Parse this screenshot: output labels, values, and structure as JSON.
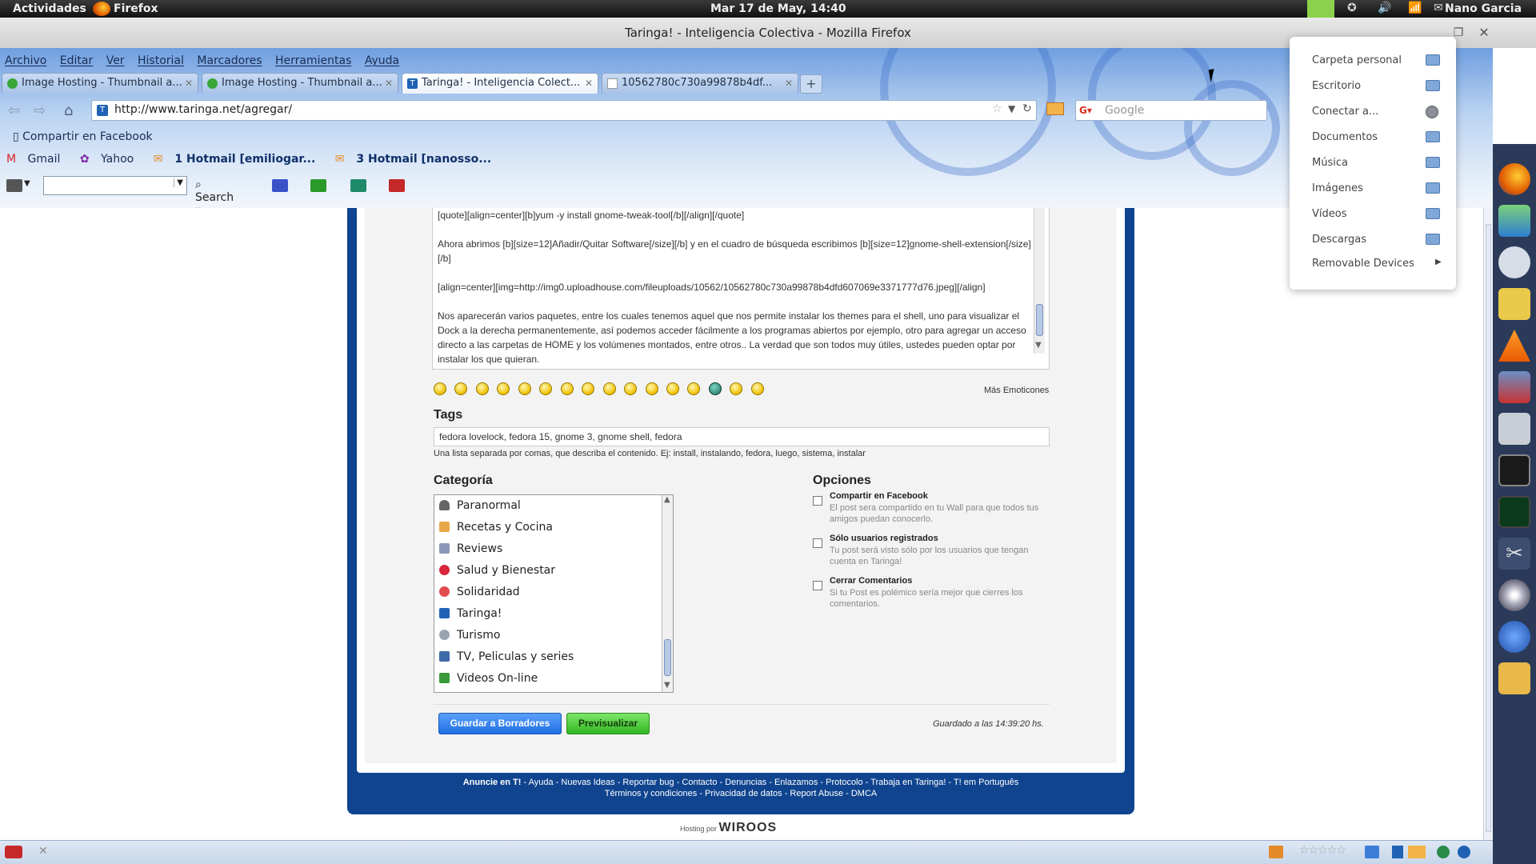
{
  "topbar": {
    "activities": "Actividades",
    "app": "Firefox",
    "clock": "Mar 17 de May, 14:40",
    "user": "Nano Garcia"
  },
  "window": {
    "title": "Taringa! - Inteligencia Colectiva - Mozilla Firefox"
  },
  "menubar": [
    "Archivo",
    "Editar",
    "Ver",
    "Historial",
    "Marcadores",
    "Herramientas",
    "Ayuda"
  ],
  "tabs": [
    {
      "label": "Image Hosting - Thumbnail a...",
      "active": false
    },
    {
      "label": "Image Hosting - Thumbnail a...",
      "active": false
    },
    {
      "label": "Taringa! - Inteligencia Colect...",
      "active": true
    },
    {
      "label": "10562780c730a99878b4df...",
      "active": false
    }
  ],
  "urlbar": {
    "url": "http://www.taringa.net/agregar/"
  },
  "searchbar": {
    "placeholder": "Google"
  },
  "bookmarks": {
    "share_facebook": "Compartir en Facebook",
    "gmail": "Gmail",
    "yahoo": "Yahoo",
    "hotmail1": "1 Hotmail [emiliogar...",
    "hotmail2": "3 Hotmail [nanosso..."
  },
  "toolbar": {
    "search_label": "Search"
  },
  "editor": {
    "lines": [
      "[quote][align=center][b]yum -y install gnome-tweak-tool[/b][/align][/quote]",
      "Ahora abrimos [b][size=12]Añadir/Quitar Software[/size][/b] y en el cuadro de búsqueda escribimos [b][size=12]gnome-shell-extension[/size][/b]",
      "[align=center][img=http://img0.uploadhouse.com/fileuploads/10562/10562780c730a99878b4dfd607069e3371777d76.jpeg][/align]",
      "Nos aparecerán varios paquetes, entre los cuales tenemos aquel que nos permite instalar los themes para el shell, uno para visualizar el Dock a la derecha permanentemente, así podemos acceder fácilmente a los programas abiertos por ejemplo, otro para agregar un acceso directo a las carpetas de HOME y los volúmenes montados, entre otros.. La verdad que son todos muy útiles, ustedes pueden optar por instalar los que quieran."
    ]
  },
  "emoticons": {
    "more_label": "Más Emoticones"
  },
  "tags": {
    "heading": "Tags",
    "value": "fedora lovelock, fedora 15, gnome 3, gnome shell, fedora",
    "help": "Una lista separada por comas, que describa el contenido. Ej: install, instalando, fedora, luego, sistema, instalar"
  },
  "category": {
    "heading": "Categoría",
    "items": [
      "Paranormal",
      "Recetas y Cocina",
      "Reviews",
      "Salud y Bienestar",
      "Solidaridad",
      "Taringa!",
      "Turismo",
      "TV, Peliculas y series",
      "Videos On-line"
    ]
  },
  "options": {
    "heading": "Opciones",
    "items": [
      {
        "title": "Compartir en Facebook",
        "desc": "El post sera compartido en tu Wall para que todos tus amigos puedan conocerlo."
      },
      {
        "title": "Sólo usuarios registrados",
        "desc": "Tu post será visto sólo por los usuarios que tengan cuenta en Taringa!"
      },
      {
        "title": "Cerrar Comentarios",
        "desc": "Si tu Post es polémico sería mejor que cierres los comentarios."
      }
    ]
  },
  "actions": {
    "save": "Guardar a Borradores",
    "preview": "Previsualizar",
    "saved_at": "Guardado a las 14:39:20 hs."
  },
  "footer": {
    "links_line1_bold": "Anuncie en T!",
    "links_line1": " - Ayuda - Nuevas Ideas - Reportar bug - Contacto - Denuncias - Enlazamos - Protocolo - Trabaja en Taringa! - T! em Português",
    "links_line2": "Términos y condiciones - Privacidad de datos - Report Abuse - DMCA",
    "hosting_prefix": "Hosting por",
    "hosting_brand": "WIROOS"
  },
  "places": {
    "items": [
      "Carpeta personal",
      "Escritorio",
      "Conectar a...",
      "Documentos",
      "Música",
      "Imágenes",
      "Vídeos",
      "Descargas",
      "Removable Devices"
    ]
  },
  "colors": {
    "accent_blue": "#10448f",
    "save_button": "#1f6ee0",
    "preview_button": "#31b720"
  }
}
